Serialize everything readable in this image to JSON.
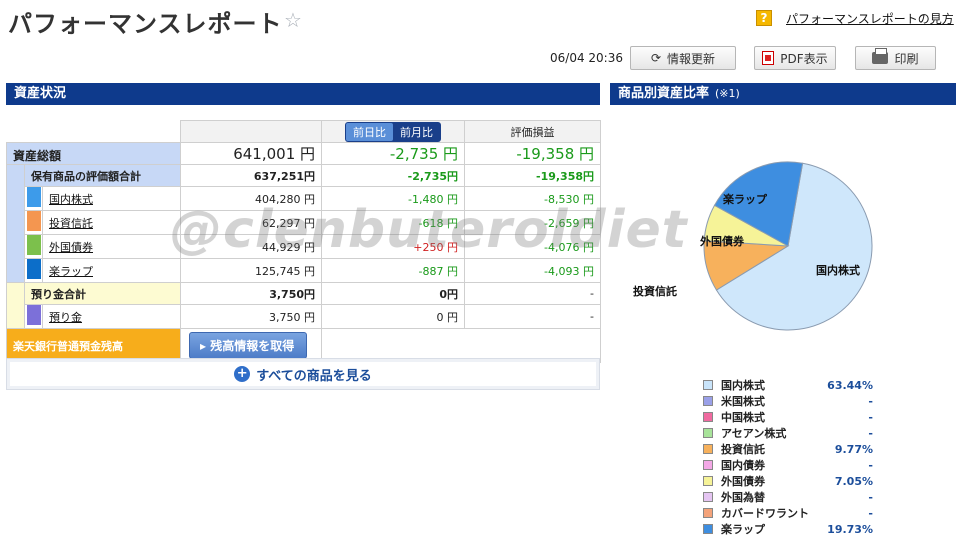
{
  "header": {
    "title": "パフォーマンスレポート",
    "help_link": "パフォーマンスレポートの見方",
    "timestamp": "06/04 20:36",
    "refresh_label": "情報更新",
    "pdf_label": "PDF表示",
    "print_label": "印刷"
  },
  "assets": {
    "section_title": "資産状況",
    "toggle": [
      "前日比",
      "前月比"
    ],
    "eval_header": "評価損益",
    "total": {
      "label": "資産総額",
      "value": "641,001 円",
      "change": "-2,735 円",
      "eval": "-19,358 円"
    },
    "holdings": {
      "label": "保有商品の評価額合計",
      "value": "637,251円",
      "change": "-2,735円",
      "eval": "-19,358円"
    },
    "items": [
      {
        "label": "国内株式",
        "color": "#3d9bea",
        "value": "404,280 円",
        "change": "-1,480 円",
        "change_color": "green",
        "eval": "-8,530 円"
      },
      {
        "label": "投資信託",
        "color": "#f49650",
        "value": "62,297 円",
        "change": "-618 円",
        "change_color": "green",
        "eval": "-2,659 円"
      },
      {
        "label": "外国債券",
        "color": "#7cc04c",
        "value": "44,929 円",
        "change": "+250 円",
        "change_color": "red",
        "eval": "-4,076 円"
      },
      {
        "label": "楽ラップ",
        "color": "#0c6ec9",
        "value": "125,745 円",
        "change": "-887 円",
        "change_color": "green",
        "eval": "-4,093 円"
      }
    ],
    "deposit_total": {
      "label": "預り金合計",
      "value": "3,750円",
      "change": "0円",
      "eval": "-"
    },
    "deposit": {
      "label": "預り金",
      "color": "#7c70d9",
      "value": "3,750 円",
      "change": "0 円",
      "eval": "-"
    },
    "bank": {
      "label": "楽天銀行普通預金残高",
      "button": "残高情報を取得"
    },
    "see_all": "すべての商品を見る",
    "watermark": "@clenbuteroldiet"
  },
  "allocation": {
    "section_title": "商品別資産比率",
    "note": "(※1)",
    "legend": [
      {
        "name": "国内株式",
        "color": "#c9e4fa",
        "value": "63.44%"
      },
      {
        "name": "米国株式",
        "color": "#9aa0e8",
        "value": "-"
      },
      {
        "name": "中国株式",
        "color": "#f06aa0",
        "value": "-"
      },
      {
        "name": "アセアン株式",
        "color": "#a8e39a",
        "value": "-"
      },
      {
        "name": "投資信託",
        "color": "#f7b15c",
        "value": "9.77%"
      },
      {
        "name": "国内債券",
        "color": "#f3a8e6",
        "value": "-"
      },
      {
        "name": "外国債券",
        "color": "#f6f398",
        "value": "7.05%"
      },
      {
        "name": "外国為替",
        "color": "#e5c5f2",
        "value": "-"
      },
      {
        "name": "カバードワラント",
        "color": "#f4a37a",
        "value": "-"
      },
      {
        "name": "楽ラップ",
        "color": "#3e8ee0",
        "value": "19.73%"
      }
    ]
  },
  "chart_data": {
    "type": "pie",
    "categories": [
      "国内株式",
      "投資信託",
      "外国債券",
      "楽ラップ"
    ],
    "values": [
      63.44,
      9.77,
      7.05,
      19.73
    ],
    "colors": [
      "#cfe7fb",
      "#f7b15c",
      "#f6f398",
      "#3e8ee0"
    ]
  }
}
